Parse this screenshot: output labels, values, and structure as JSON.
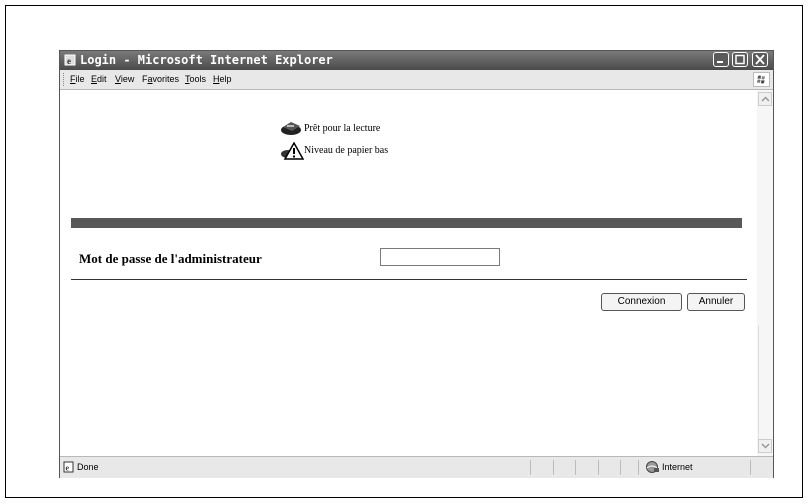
{
  "window": {
    "title": "Login - Microsoft Internet Explorer"
  },
  "menu": {
    "items": [
      {
        "accel": "F",
        "rest": "ile"
      },
      {
        "accel": "E",
        "rest": "dit"
      },
      {
        "accel": "V",
        "rest": "iew"
      },
      {
        "pre": "F",
        "accel": "a",
        "rest": "vorites"
      },
      {
        "accel": "T",
        "rest": "ools"
      },
      {
        "accel": "H",
        "rest": "elp"
      }
    ]
  },
  "printer_status": {
    "ready": "Prêt pour la lecture",
    "warning": "Niveau de papier bas"
  },
  "login_form": {
    "password_label": "Mot de passe de l'administrateur",
    "password_value": "",
    "connect_button": "Connexion",
    "cancel_button": "Annuler"
  },
  "statusbar": {
    "status_text": "Done",
    "zone": "Internet"
  },
  "icons": [
    "ie-icon",
    "minimize-icon",
    "maximize-icon",
    "close-icon",
    "windows-flag-icon",
    "printer-icon",
    "warning-icon",
    "scroll-up-icon",
    "scroll-down-icon",
    "page-icon",
    "globe-icon"
  ]
}
